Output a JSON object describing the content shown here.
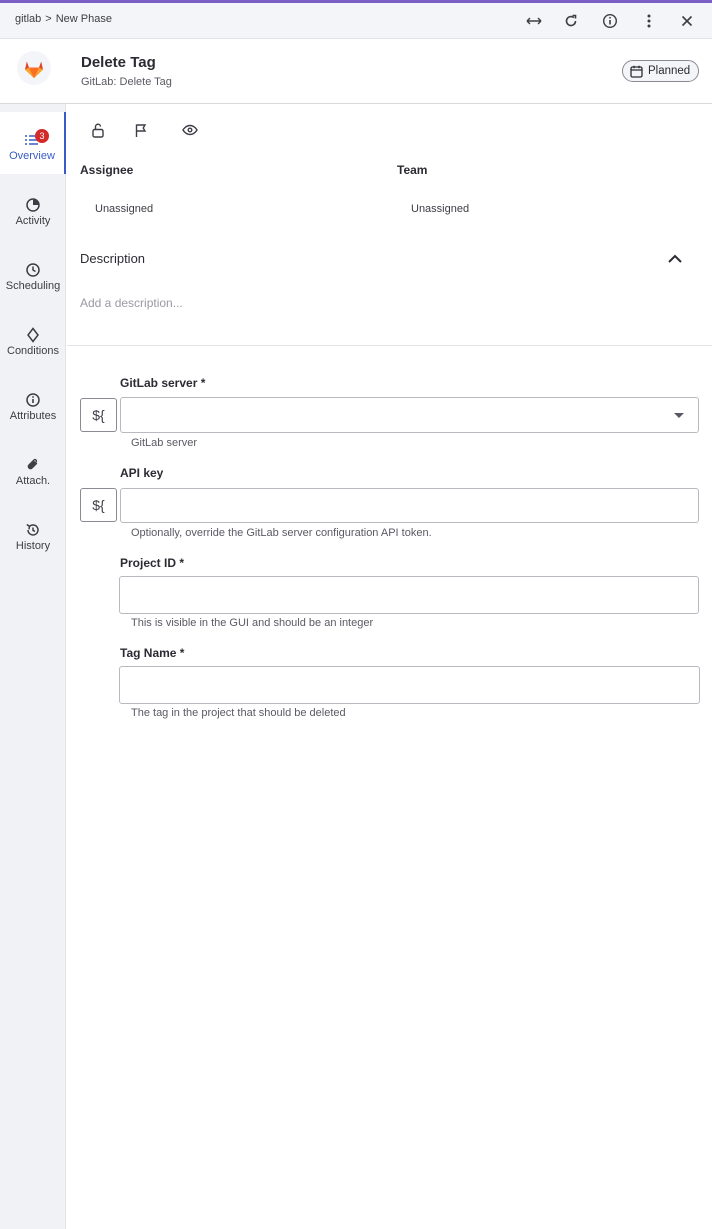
{
  "titlebar": {
    "breadcrumb_root": "gitlab",
    "breadcrumb_sep": ">",
    "breadcrumb_current": "New Phase"
  },
  "header": {
    "title": "Delete Tag",
    "subtitle": "GitLab: Delete Tag",
    "status": "Planned"
  },
  "sidebar": {
    "overview_badge": "3",
    "items": [
      {
        "label": "Overview"
      },
      {
        "label": "Activity"
      },
      {
        "label": "Scheduling"
      },
      {
        "label": "Conditions"
      },
      {
        "label": "Attributes"
      },
      {
        "label": "Attach."
      },
      {
        "label": "History"
      }
    ]
  },
  "overview": {
    "assignee_label": "Assignee",
    "assignee_value": "Unassigned",
    "team_label": "Team",
    "team_value": "Unassigned",
    "description_label": "Description",
    "description_placeholder": "Add a description..."
  },
  "form": {
    "var_button_label": "${",
    "gitlab_server": {
      "label": "GitLab server *",
      "value": "",
      "helper": "GitLab server"
    },
    "api_key": {
      "label": "API key",
      "value": "",
      "helper": "Optionally, override the GitLab server configuration API token."
    },
    "project_id": {
      "label": "Project ID *",
      "value": "",
      "helper": "This is visible in the GUI and should be an integer"
    },
    "tag_name": {
      "label": "Tag Name *",
      "value": "",
      "helper": "The tag in the project that should be deleted"
    }
  },
  "colors": {
    "accent": "#3a5bc7",
    "top_bar": "#7b5fc4",
    "badge": "#d42a2a",
    "gitlab_orange": "#e24329"
  }
}
